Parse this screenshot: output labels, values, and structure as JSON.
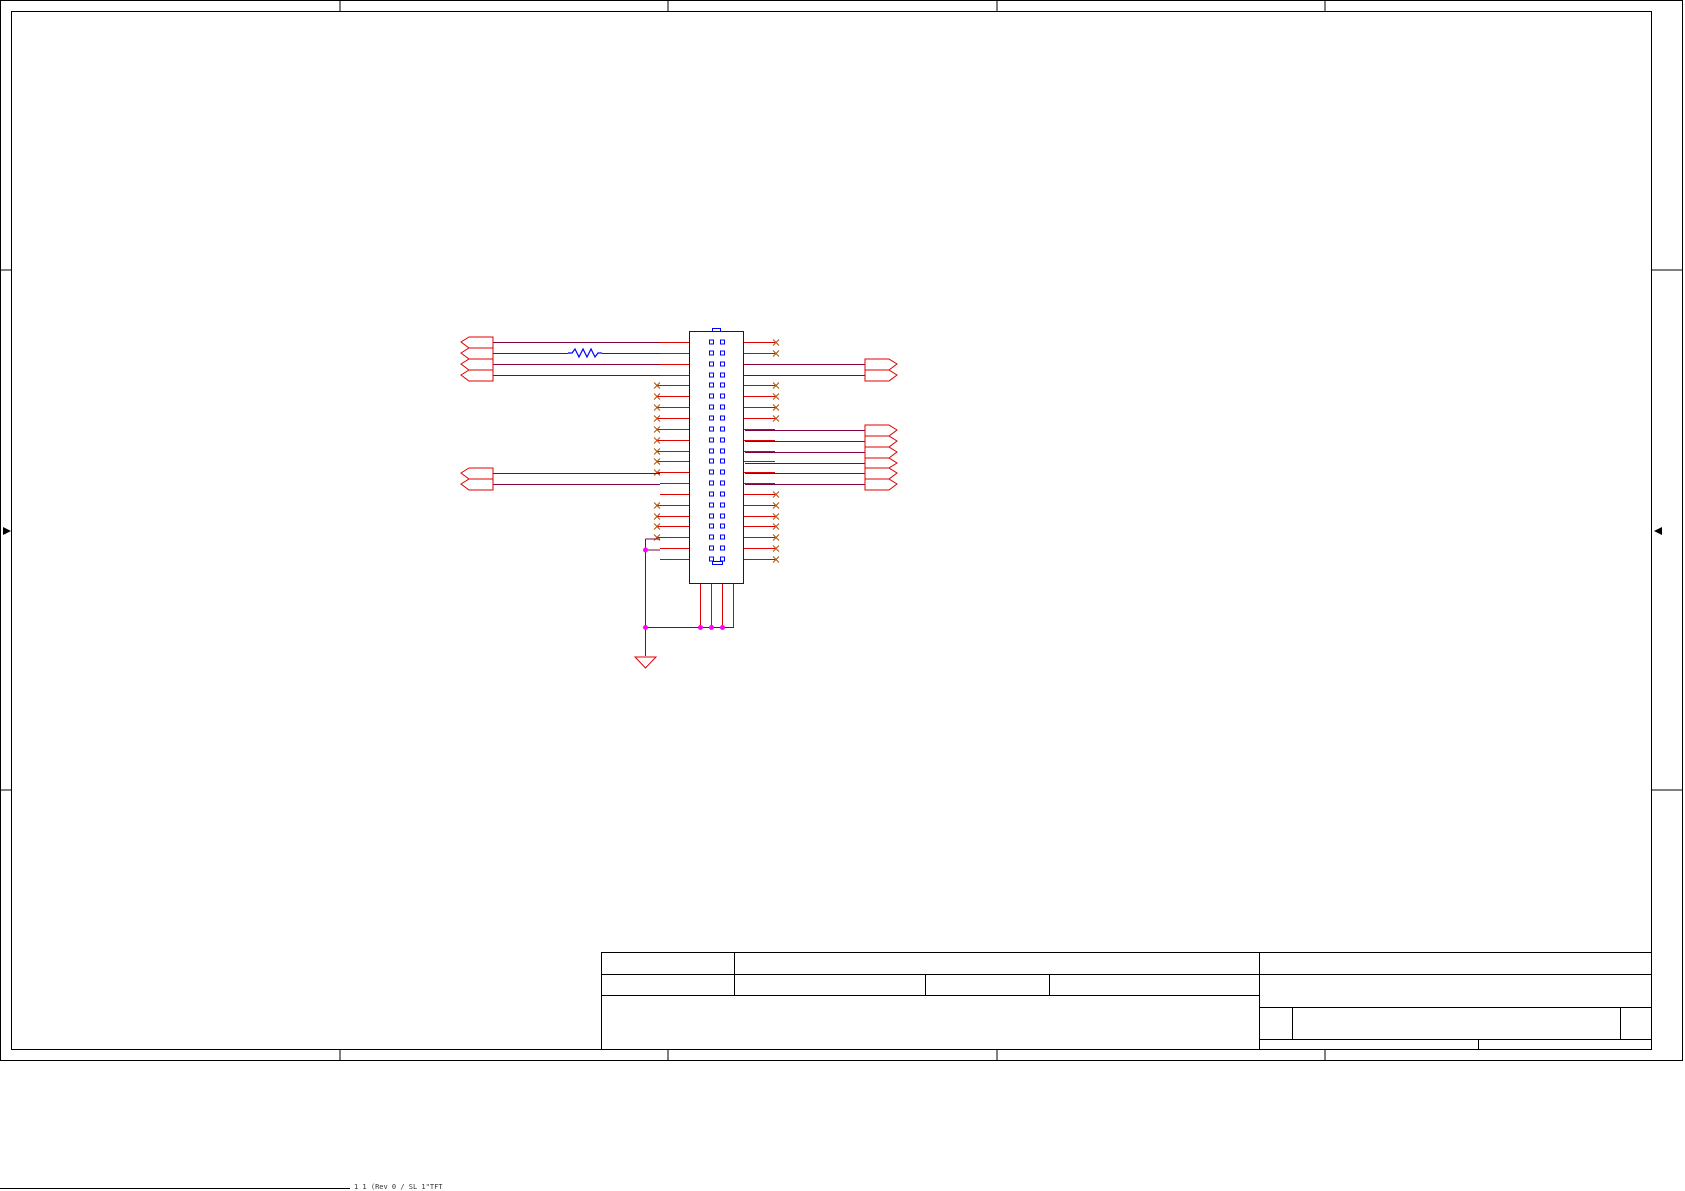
{
  "sheet": {
    "colors": {
      "border": "#000000",
      "wire": "#e00000",
      "net": "#800040",
      "component": "#0000ff",
      "junction": "#ff00ff",
      "no_connect": "#b05000"
    }
  },
  "connector": {
    "left_pins": [
      "wire",
      "wire",
      "wire",
      "wire",
      "nc",
      "nc",
      "nc",
      "nc",
      "nc",
      "nc",
      "nc",
      "nc",
      "nc",
      "wire",
      "wire",
      "nc",
      "nc",
      "nc",
      "nc",
      "wire",
      "wire"
    ],
    "right_pins": [
      "nc",
      "nc",
      "wire",
      "wire",
      "nc",
      "nc",
      "nc",
      "nc",
      "wire",
      "wire",
      "wire",
      "wire",
      "wire",
      "wire",
      "nc",
      "nc",
      "nc",
      "nc",
      "nc",
      "nc",
      "nc"
    ]
  },
  "ports": {
    "left_group_1_count": 4,
    "left_group_2_count": 2,
    "right_group_1_count": 2,
    "right_group_2_count": 6
  },
  "status_bar": {
    "text": "1  1  (Rev 0 / SL 1\"TFT"
  }
}
